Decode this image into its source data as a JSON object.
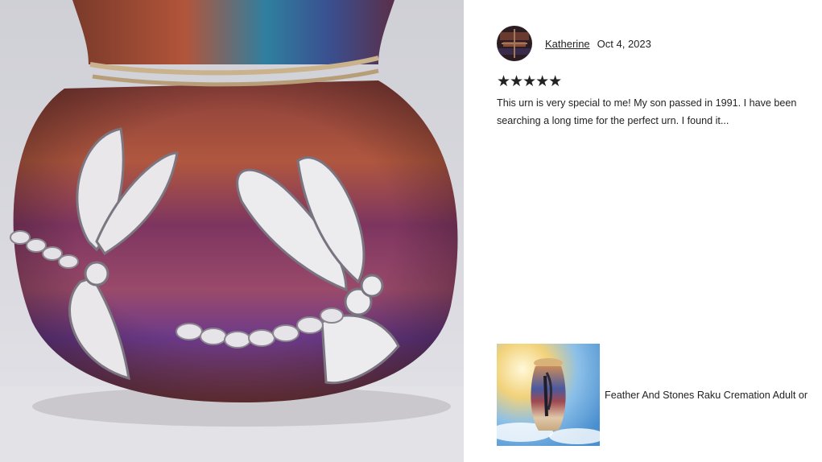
{
  "review": {
    "reviewer_name": "Katherine",
    "date": "Oct 4, 2023",
    "rating": 5,
    "stars_text": "★★★★★",
    "text": "This urn is very special to me! My son passed in 1991. I have been searching a long time for the perfect urn. I found it..."
  },
  "listing": {
    "title": "Feather And Stones Raku Cremation Adult or"
  },
  "colors": {
    "text": "#222222",
    "background": "#ffffff"
  }
}
